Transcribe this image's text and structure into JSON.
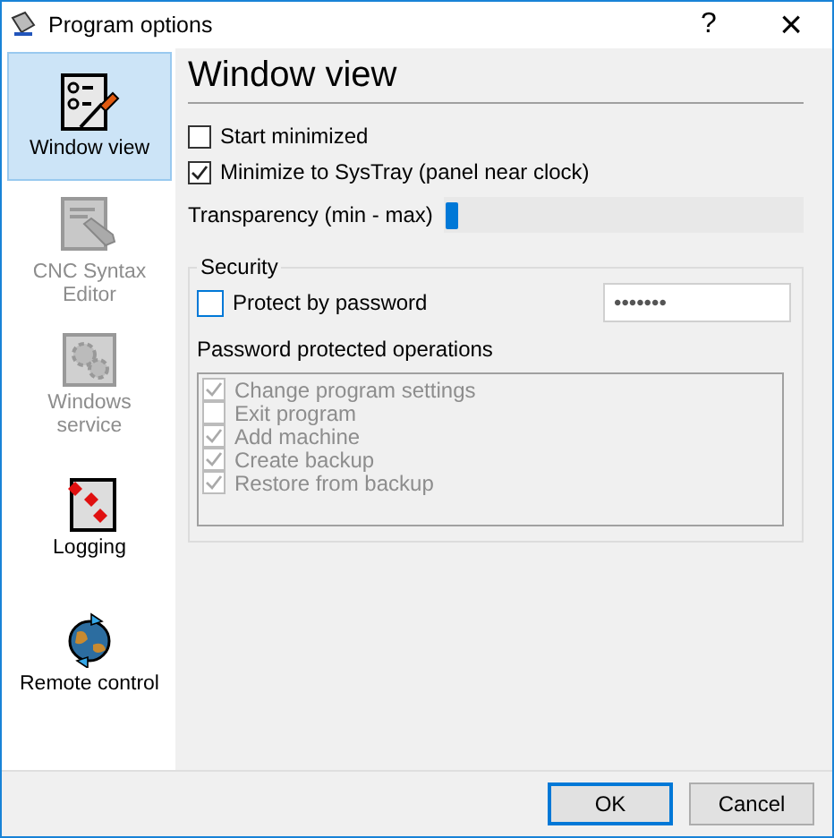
{
  "window": {
    "title": "Program options",
    "help": "?",
    "close": "×"
  },
  "sidebar": {
    "items": [
      {
        "kind": "view",
        "label": "Window view",
        "selected": true,
        "disabled": false
      },
      {
        "kind": "editor",
        "label": "CNC Syntax Editor",
        "selected": false,
        "disabled": true
      },
      {
        "kind": "service",
        "label": "Windows service",
        "selected": false,
        "disabled": true
      },
      {
        "kind": "log",
        "label": "Logging",
        "selected": false,
        "disabled": false
      },
      {
        "kind": "remote",
        "label": "Remote control",
        "selected": false,
        "disabled": false
      }
    ]
  },
  "page": {
    "heading": "Window view",
    "options": [
      {
        "label": "Start minimized",
        "checked": false
      },
      {
        "label": "Minimize to SysTray (panel near clock)",
        "checked": true
      }
    ],
    "transparency": {
      "label": "Transparency (min - max)",
      "level": 0
    },
    "security": {
      "title": "Security",
      "protect": {
        "label": "Protect by password",
        "checked": false
      },
      "password": {
        "value": "•••••••"
      },
      "operations_label": "Password protected operations",
      "operations": [
        {
          "label": "Change program settings",
          "checked": true,
          "disabled": true
        },
        {
          "label": "Exit program",
          "checked": false,
          "disabled": true
        },
        {
          "label": "Add machine",
          "checked": true,
          "disabled": true
        },
        {
          "label": "Create backup",
          "checked": true,
          "disabled": true
        },
        {
          "label": "Restore from backup",
          "checked": true,
          "disabled": true
        }
      ]
    }
  },
  "buttons": [
    {
      "label": "OK",
      "default": true
    },
    {
      "label": "Cancel",
      "default": false
    }
  ]
}
